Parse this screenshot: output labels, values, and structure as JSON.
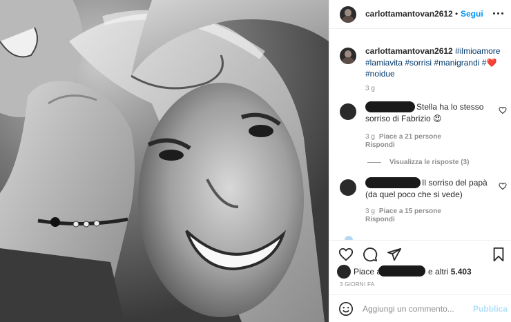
{
  "header": {
    "username": "carlottamantovan2612",
    "separator": "•",
    "follow_label": "Segui"
  },
  "caption": {
    "username": "carlottamantovan2612",
    "tags": [
      "#ilmioamore",
      "#lamiavita",
      "#sorrisi",
      "#manigrandi",
      "#",
      "#noidue"
    ],
    "heart_emoji": "❤️",
    "time": "3 g"
  },
  "comments": [
    {
      "text": "Stella ha lo stesso sorriso di Fabrizio 😍",
      "time": "3 g",
      "likes": "Piace a 21 persone",
      "reply_label": "Rispondi",
      "view_replies": "Visualizza le risposte (3)"
    },
    {
      "text": "Il sorriso del papà (da quel poco che si vede)",
      "time": "3 g",
      "likes": "Piace a 15 persone",
      "reply_label": "Rispondi"
    }
  ],
  "likes": {
    "prefix": "Piace a",
    "suffix_plain": "e altri",
    "suffix_count": "5.403"
  },
  "posted_ago": "3 GIORNI FA",
  "comment_box": {
    "placeholder": "Aggiungi un commento...",
    "submit_label": "Pubblica"
  },
  "colors": {
    "accent": "#0095f6",
    "hashtag": "#00376b",
    "muted": "#8e8e8e",
    "submit_disabled": "#b2dffc",
    "heart": "#ed4956"
  },
  "icons": {
    "like": "heart-outline-icon",
    "comment": "comment-bubble-icon",
    "share": "paper-plane-icon",
    "save": "bookmark-icon",
    "emoji": "emoji-icon",
    "more": "more-options-icon"
  }
}
